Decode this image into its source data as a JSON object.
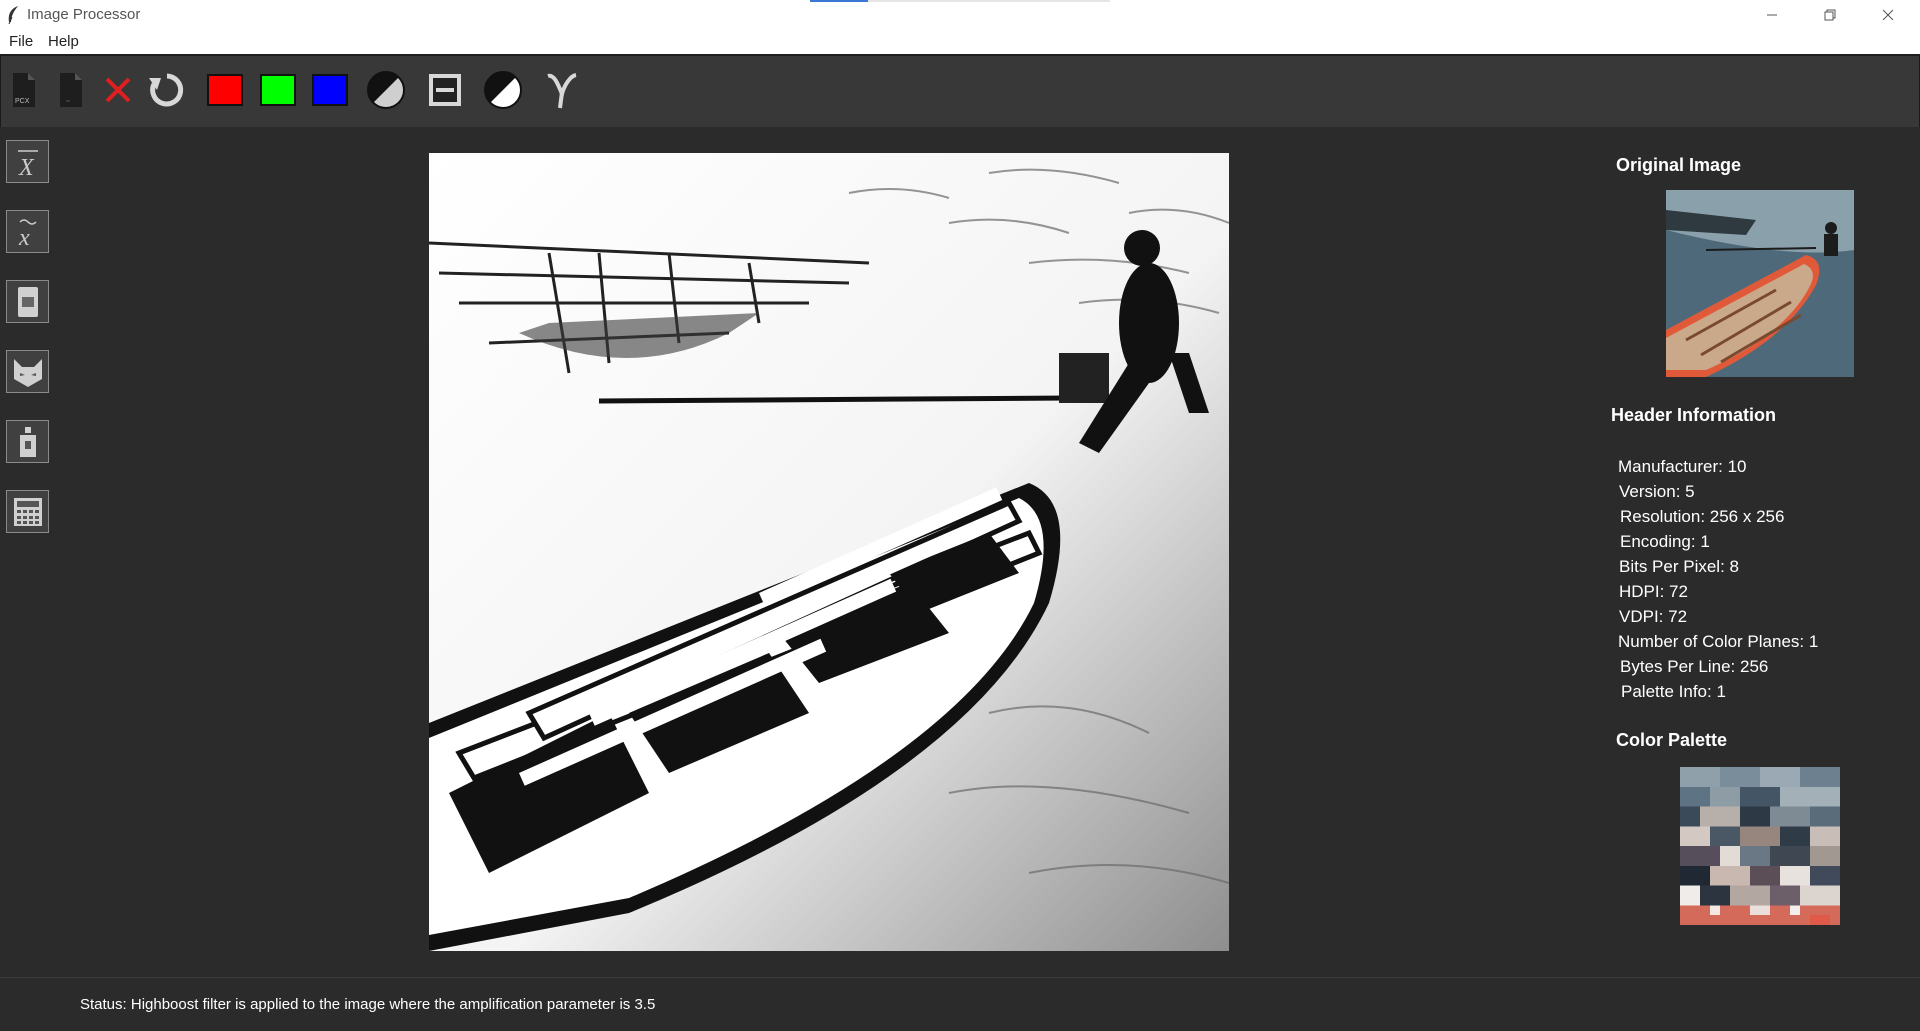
{
  "window": {
    "title": "Image Processor"
  },
  "menu": {
    "items": [
      "File",
      "Help"
    ]
  },
  "toolbar": {
    "buttons": [
      {
        "name": "open-pcx",
        "label": "PCX"
      },
      {
        "name": "save",
        "label": ""
      },
      {
        "name": "close",
        "label": ""
      },
      {
        "name": "reset",
        "label": ""
      },
      {
        "name": "red-channel",
        "color": "#ff0000"
      },
      {
        "name": "green-channel",
        "color": "#00ff00"
      },
      {
        "name": "blue-channel",
        "color": "#0000ff"
      },
      {
        "name": "grayscale",
        "label": ""
      },
      {
        "name": "threshold",
        "label": ""
      },
      {
        "name": "negative",
        "label": ""
      },
      {
        "name": "gamma",
        "label": ""
      }
    ]
  },
  "sidebar": {
    "tools": [
      "mean-filter",
      "median-filter",
      "laplacian-filter",
      "highboost-filter",
      "gradient-filter",
      "histogram-equalization"
    ]
  },
  "right_panel": {
    "original_title": "Original Image",
    "header_title": "Header Information",
    "header_lines": [
      "Manufacturer: 10",
      "Version: 5",
      "Resolution: 256 x 256",
      "Encoding: 1",
      "Bits Per Pixel: 8",
      "HDPI: 72",
      "VDPI: 72",
      "Number of Color Planes: 1",
      "Bytes Per Line: 256",
      "Palette Info: 1"
    ],
    "palette_title": "Color Palette"
  },
  "status": {
    "text": "Status: Highboost filter is applied to the image where the amplification parameter is 3.5"
  },
  "colors": {
    "accent": "#3b78d4",
    "panel": "#2b2b2b",
    "toolbar": "#383838"
  }
}
